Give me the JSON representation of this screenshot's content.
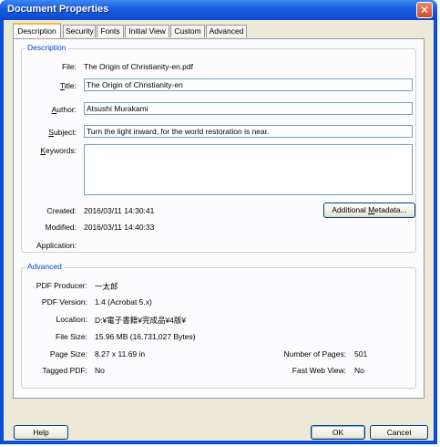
{
  "window": {
    "title": "Document Properties",
    "close_glyph": "✕"
  },
  "tabs": [
    "Description",
    "Security",
    "Fonts",
    "Initial View",
    "Custom",
    "Advanced"
  ],
  "description": {
    "group_title": "Description",
    "file_label": "File:",
    "file_value": "The Origin of Christianity-en.pdf",
    "title_label_pre": "",
    "title_label_key": "T",
    "title_label_post": "itle:",
    "title_value": "The Origin of Christianity-en",
    "author_label_pre": "",
    "author_label_key": "A",
    "author_label_post": "uthor:",
    "author_value": "Atsushi Murakami",
    "subject_label_pre": "",
    "subject_label_key": "S",
    "subject_label_post": "ubject:",
    "subject_value": "Turn the light inward, for the world restoration is near.",
    "keywords_label_pre": "",
    "keywords_label_key": "K",
    "keywords_label_post": "eywords:",
    "keywords_value": "",
    "created_label": "Created:",
    "created_value": "2016/03/11 14:30:41",
    "modified_label": "Modified:",
    "modified_value": "2016/03/11 14:40:33",
    "application_label": "Application:",
    "application_value": "",
    "metadata_btn_pre": "Additional ",
    "metadata_btn_key": "M",
    "metadata_btn_post": "etadata..."
  },
  "advanced": {
    "group_title": "Advanced",
    "producer_label": "PDF Producer:",
    "producer_value": "一太郎",
    "version_label": "PDF Version:",
    "version_value": "1.4 (Acrobat 5.x)",
    "location_label": "Location:",
    "location_value": "D:¥電子書籍¥完成品¥4版¥",
    "filesize_label": "File Size:",
    "filesize_value": "15.96 MB (16,731,027 Bytes)",
    "pagesize_label": "Page Size:",
    "pagesize_value": "8.27 x 11.69 in",
    "pages_label": "Number of Pages:",
    "pages_value": "501",
    "tagged_label": "Tagged PDF:",
    "tagged_value": "No",
    "fastweb_label": "Fast Web View:",
    "fastweb_value": "No"
  },
  "footer": {
    "help_label": "Help",
    "ok_label": "OK",
    "cancel_label": "Cancel"
  }
}
